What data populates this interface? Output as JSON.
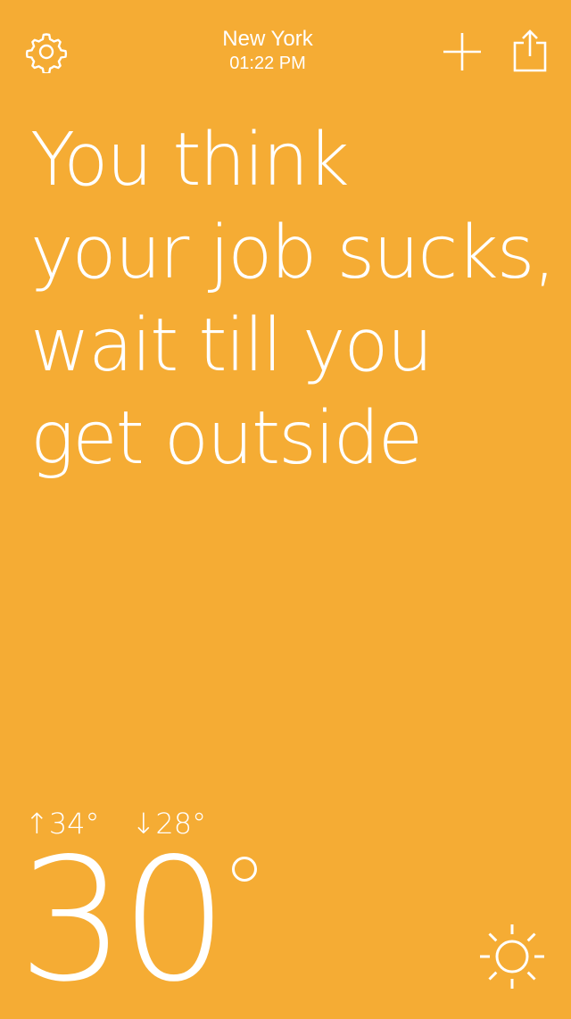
{
  "app": {
    "background_color": "#F5AC34",
    "text_color": "#FFFFFF"
  },
  "header": {
    "city": "New York",
    "time": "01:22 PM",
    "icons": {
      "settings": "gear-icon",
      "add": "plus-icon",
      "share": "share-icon"
    }
  },
  "message": {
    "lines": [
      "You think",
      "your job sucks,",
      "wait till you",
      "get outside"
    ]
  },
  "weather": {
    "high": "34°",
    "low": "28°",
    "high_arrow": "↑",
    "low_arrow": "↓",
    "current_temp": "30",
    "condition_icon": "sun-icon"
  }
}
